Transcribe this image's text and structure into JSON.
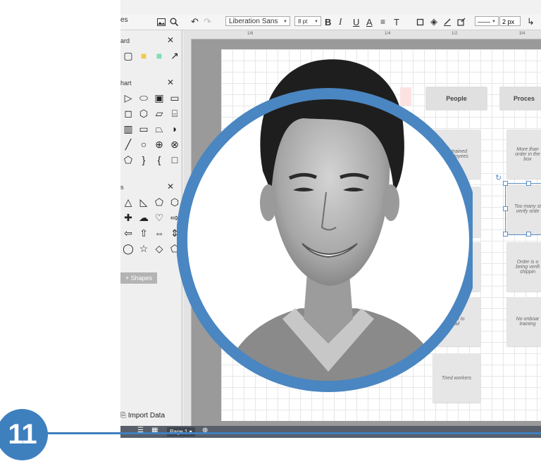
{
  "toolbar": {
    "panel_title": "es",
    "font_family": "Liberation Sans",
    "font_size": "8 pt",
    "line_width": "2 px",
    "bold_label": "B",
    "italic_label": "I",
    "underline_label": "U",
    "color_label": "A",
    "text_style_label": "T",
    "ruler_marks": [
      "1/6",
      "1/4",
      "1/2",
      "3/4"
    ]
  },
  "left_panel": {
    "sections": [
      {
        "title": "ard"
      },
      {
        "title": "hart"
      },
      {
        "title": "s"
      }
    ],
    "close_glyph": "✕",
    "shapes_button": "+ Shapes",
    "import_label": "Import Data"
  },
  "diagram": {
    "headers": [
      "People",
      "Proces"
    ],
    "cards_people": [
      "Untrained\nemployees",
      "ntion to\ntail",
      "Tired workers"
    ],
    "cards_process": [
      "More than\norder in the\nbox",
      "Too many st\nverify orde",
      "Order is o\nbeing verifi\nshippin",
      "No onboar\ntraining"
    ]
  },
  "bottom": {
    "page_tab": "Page 1 ▾"
  },
  "overlay": {
    "number": "11",
    "accent_color": "#3e80be"
  }
}
